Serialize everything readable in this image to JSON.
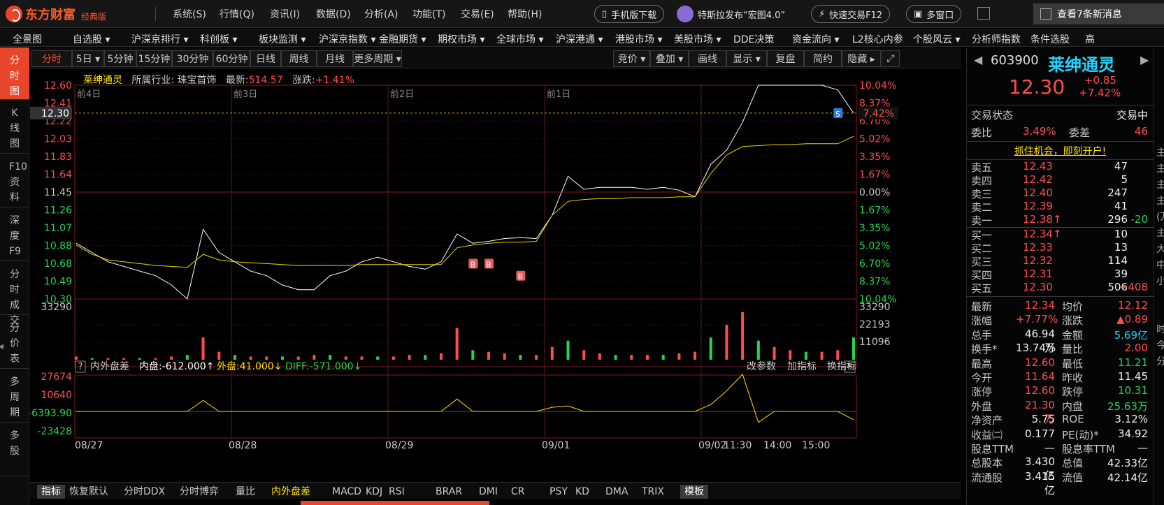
{
  "app": {
    "brand": "东方财富",
    "edition": "经典版"
  },
  "menu": [
    "系统(S)",
    "行情(Q)",
    "资讯(I)",
    "数据(D)",
    "分析(A)",
    "功能(T)",
    "交易(E)",
    "帮助(H)"
  ],
  "pills": {
    "mobile": "手机版下载",
    "news": "特斯拉发布“宏图4.0”",
    "trade": "快速交易F12",
    "window": "多窗口",
    "messages": "查看7条新消息"
  },
  "nav": [
    "全景图",
    "自选股 ▾",
    "沪深京排行 ▾",
    "科创板 ▾",
    "板块监测 ▾",
    "沪深京指数 ▾",
    "金融期货 ▾",
    "期权市场 ▾",
    "全球市场 ▾",
    "沪深港通 ▾",
    "港股市场 ▾",
    "美股市场 ▾",
    "DDE决策",
    "资金流向 ▾",
    "L2核心内参",
    "个股风云 ▾",
    "分析师指数",
    "条件选股",
    "高"
  ],
  "left_side": [
    "分时图",
    "K线图",
    "F10资料",
    "深度F9",
    "分时成交",
    "分价表",
    "多周期",
    "多股"
  ],
  "period_tabs": [
    "分时",
    "5日 ▾",
    "5分钟",
    "15分钟",
    "30分钟",
    "60分钟",
    "日线",
    "周线",
    "月线",
    "更多周期 ▾"
  ],
  "tool_tabs": [
    "竞价 ▾",
    "叠加 ▾",
    "画线",
    "显示 ▾",
    "复盘",
    "简约",
    "隐藏 ▸"
  ],
  "stock_line": {
    "name": "莱绅通灵",
    "industry_label": "所属行业:",
    "industry": "珠宝首饰",
    "latest_label": "最新:",
    "latest": "514.57",
    "change_label": "涨跌:",
    "change": "+1.41%"
  },
  "chart_data": {
    "type": "line",
    "day_labels": [
      "前4日",
      "前3日",
      "前2日",
      "前1日"
    ],
    "x_dates": [
      "08/27",
      "08/28",
      "08/29",
      "09/01",
      "09/02"
    ],
    "x_times": [
      "11:30",
      "14:00",
      "15:00"
    ],
    "price_ticks": [
      "12.60",
      "12.41",
      "12.22",
      "12.03",
      "11.83",
      "11.64",
      "11.45",
      "11.26",
      "11.07",
      "10.88",
      "10.68",
      "10.49",
      "10.30"
    ],
    "pct_ticks": [
      "10.04%",
      "8.37%",
      "6.70%",
      "5.02%",
      "3.35%",
      "1.67%",
      "0.00%",
      "1.67%",
      "3.35%",
      "5.02%",
      "6.70%",
      "8.37%",
      "10.04%"
    ],
    "current_price": "12.30",
    "current_pct": "7.42%",
    "ylim": [
      10.3,
      12.6
    ],
    "price_series": [
      10.9,
      10.8,
      10.7,
      10.65,
      10.6,
      10.55,
      10.45,
      10.3,
      11.05,
      10.8,
      10.7,
      10.6,
      10.55,
      10.45,
      10.4,
      10.4,
      10.55,
      10.6,
      10.7,
      10.75,
      10.7,
      10.65,
      10.62,
      10.7,
      11.0,
      10.9,
      10.92,
      10.95,
      10.96,
      10.95,
      11.2,
      11.62,
      11.48,
      11.5,
      11.5,
      11.5,
      11.48,
      11.5,
      11.47,
      11.4,
      11.75,
      11.9,
      12.2,
      12.6,
      12.6,
      12.6,
      12.6,
      12.6,
      12.55,
      12.3
    ],
    "avg_series": [
      10.88,
      10.78,
      10.72,
      10.7,
      10.68,
      10.66,
      10.65,
      10.64,
      10.78,
      10.72,
      10.7,
      10.69,
      10.68,
      10.67,
      10.66,
      10.66,
      10.66,
      10.66,
      10.67,
      10.67,
      10.67,
      10.67,
      10.67,
      10.67,
      10.85,
      10.88,
      10.9,
      10.91,
      10.91,
      10.92,
      11.2,
      11.35,
      11.37,
      11.38,
      11.38,
      11.39,
      11.39,
      11.39,
      11.4,
      11.4,
      11.65,
      11.85,
      11.94,
      11.95,
      11.96,
      11.96,
      11.97,
      11.97,
      11.97,
      12.05
    ],
    "volume_ticks": [
      "33290",
      "22193",
      "11096"
    ],
    "volume_series": [
      2,
      1,
      1,
      1,
      1,
      1,
      2,
      3,
      14,
      5,
      3,
      2,
      2,
      2,
      2,
      3,
      3,
      2,
      2,
      2,
      2,
      3,
      3,
      4,
      20,
      6,
      5,
      4,
      3,
      3,
      8,
      12,
      6,
      4,
      3,
      3,
      3,
      3,
      4,
      5,
      14,
      22,
      30,
      12,
      8,
      6,
      5,
      5,
      6,
      14
    ],
    "indicator_ticks": [
      "27674",
      "10640",
      "-6393.90",
      "-23428"
    ],
    "indicator_series": [
      0,
      0,
      0,
      0,
      0,
      0,
      0,
      0,
      8000,
      0,
      0,
      0,
      0,
      0,
      0,
      0,
      0,
      0,
      0,
      0,
      0,
      0,
      0,
      0,
      9000,
      0,
      0,
      0,
      0,
      0,
      3000,
      4000,
      0,
      0,
      0,
      0,
      0,
      0,
      0,
      0,
      5000,
      15000,
      27000,
      -8000,
      0,
      0,
      0,
      0,
      0,
      -6000
    ],
    "markers": [
      {
        "label": "B"
      },
      {
        "label": "B"
      },
      {
        "label": "B"
      },
      {
        "label": "S"
      }
    ]
  },
  "indicator_bar": {
    "help": "?",
    "name": "内外盘差",
    "inner": "内盘:-612.000↑",
    "outer": "外盘:41.000↓",
    "diff": "DIFF:-571.000↓",
    "actions": [
      "改参数",
      "加指标",
      "换指标"
    ]
  },
  "bottom_tabs": [
    "指标",
    "恢复默认",
    "分时DDX",
    "分时博弈",
    "量比",
    "内外盘差",
    "MACD",
    "KDJ",
    "RSI",
    "BRAR",
    "DMI",
    "CR",
    "PSY",
    "KD",
    "DMA",
    "TRIX",
    "模板"
  ],
  "quote": {
    "code": "603900",
    "name": "莱绅通灵",
    "price": "12.30",
    "chg": "+0.85",
    "pct": "+7.42%",
    "status_label": "交易状态",
    "status": "交易中",
    "ratio_label": "委比",
    "ratio": "3.49%",
    "diff_label": "委差",
    "diff": "46",
    "promo": "抓住机会，即刻开户!",
    "asks": [
      {
        "l": "卖五",
        "p": "12.43",
        "v": "47",
        "c": ""
      },
      {
        "l": "卖四",
        "p": "12.42",
        "v": "5",
        "c": ""
      },
      {
        "l": "卖三",
        "p": "12.40",
        "v": "247",
        "c": ""
      },
      {
        "l": "卖二",
        "p": "12.39",
        "v": "41",
        "c": ""
      },
      {
        "l": "卖一",
        "p": "12.38↑",
        "v": "296",
        "c": "-20"
      }
    ],
    "bids": [
      {
        "l": "买一",
        "p": "12.34↑",
        "v": "10",
        "c": ""
      },
      {
        "l": "买二",
        "p": "12.33",
        "v": "13",
        "c": ""
      },
      {
        "l": "买三",
        "p": "12.32",
        "v": "114",
        "c": ""
      },
      {
        "l": "买四",
        "p": "12.31",
        "v": "39",
        "c": ""
      },
      {
        "l": "买五",
        "p": "12.30",
        "v": "506",
        "c": "+408"
      }
    ],
    "stats": [
      [
        "最新",
        "12.34",
        "r",
        "均价",
        "12.12",
        "r"
      ],
      [
        "涨幅",
        "+7.77%",
        "r",
        "涨跌",
        "▲0.89",
        "r"
      ],
      [
        "总手",
        "46.94万",
        "w",
        "金额",
        "5.69亿",
        "cy"
      ],
      [
        "换手*",
        "13.74%",
        "w",
        "量比",
        "2.00",
        "r"
      ],
      [
        "最高",
        "12.60",
        "r",
        "最低",
        "11.21",
        "g"
      ],
      [
        "今开",
        "11.64",
        "r",
        "昨收",
        "11.45",
        "w"
      ],
      [
        "涨停",
        "12.60",
        "r",
        "跌停",
        "10.31",
        "g"
      ],
      [
        "外盘",
        "21.30万",
        "r",
        "内盘",
        "25.63万",
        "g"
      ],
      [
        "净资产",
        "5.75",
        "w",
        "ROE",
        "3.12%",
        "w"
      ],
      [
        "收益㈡",
        "0.177",
        "w",
        "PE(动)*",
        "34.92",
        "w"
      ],
      [
        "股息TTM",
        "—",
        "w",
        "股息率TTM",
        "—",
        "w"
      ],
      [
        "总股本",
        "3.430亿",
        "w",
        "总值",
        "42.33亿",
        "w"
      ],
      [
        "流通股",
        "3.415亿",
        "w",
        "流值",
        "42.14亿",
        "w"
      ]
    ]
  },
  "right_cut": [
    "主",
    "主",
    "主",
    "主",
    "(万",
    "主",
    "大",
    "中",
    "小",
    "",
    "",
    "时",
    "今",
    "分"
  ],
  "colors": {
    "accent": "#e8462b",
    "up": "#ff4d4d",
    "down": "#24d64f",
    "avg_line": "#e8d800",
    "price_line": "#ffffff"
  }
}
